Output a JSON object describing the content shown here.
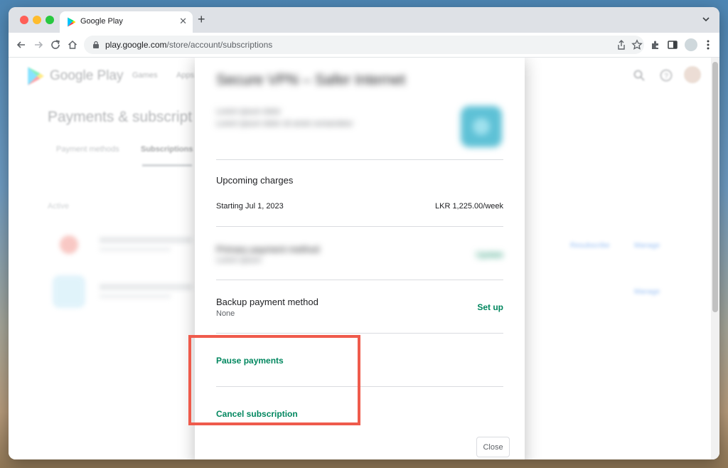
{
  "browser": {
    "tab_title": "Google Play",
    "new_tab_icon": "plus-icon",
    "tab_close_icon": "close-icon",
    "url_host": "play.google.com",
    "url_path": "/store/account/subscriptions"
  },
  "store": {
    "logo_text": "Google Play",
    "nav": [
      "Games",
      "Apps"
    ],
    "page_title": "Payments & subscript",
    "tabs": [
      "Payment methods",
      "Subscriptions"
    ],
    "section_label": "Active",
    "row1_action_1": "Resubscribe",
    "row1_action_2": "Manage",
    "row2_action": "Manage"
  },
  "dialog": {
    "app_name": "Secure VPN – Safer Internet",
    "app_sub_1": "Lorem ipsum dolor",
    "app_sub_2": "Lorem ipsum dolor sit amet consectetur",
    "upcoming_heading": "Upcoming charges",
    "start_text": "Starting Jul 1, 2023",
    "price_text": "LKR 1,225.00/week",
    "payment_method_label": "Primary payment method",
    "payment_method_sub": "Lorem ipsum",
    "payment_method_link": "Update",
    "backup_heading": "Backup payment method",
    "backup_value": "None",
    "setup_label": "Set up",
    "pause_label": "Pause payments",
    "cancel_label": "Cancel subscription",
    "close_label": "Close"
  },
  "colors": {
    "accent": "#01875f",
    "highlight": "#ef5b4c"
  }
}
